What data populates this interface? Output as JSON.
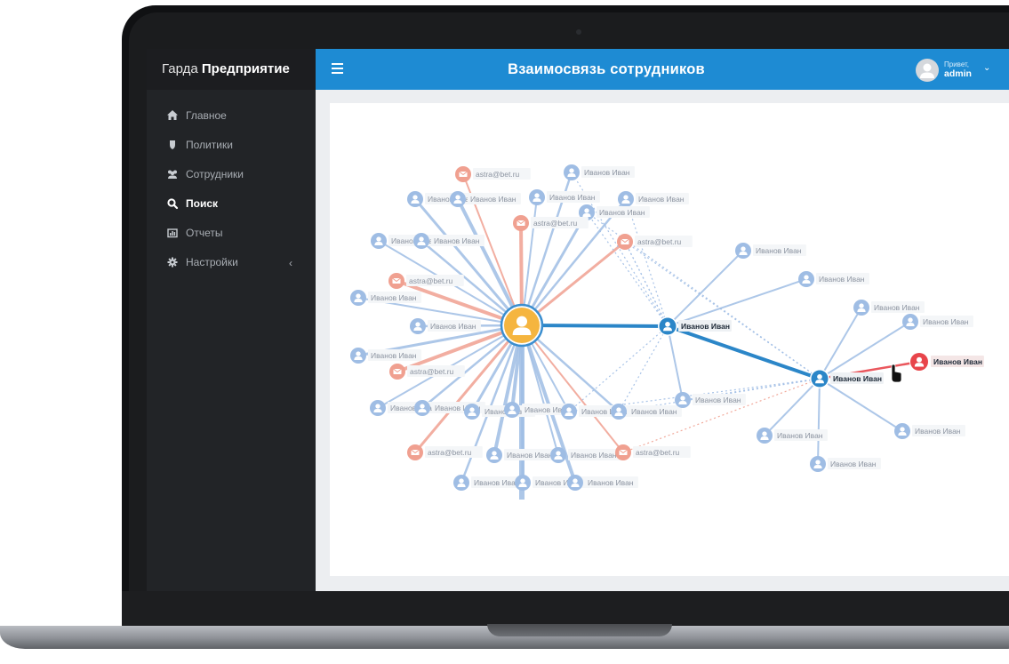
{
  "app": {
    "brand_prefix": "Гарда",
    "brand_name": "Предприятие"
  },
  "header": {
    "title": "Взаимосвязь сотрудников",
    "greeting": "Привет,",
    "username": "admin"
  },
  "sidebar": {
    "items": [
      {
        "label": "Главное",
        "icon": "home-icon",
        "active": false
      },
      {
        "label": "Политики",
        "icon": "shield-icon",
        "active": false
      },
      {
        "label": "Сотрудники",
        "icon": "users-icon",
        "active": false
      },
      {
        "label": "Поиск",
        "icon": "search-icon",
        "active": true
      },
      {
        "label": "Отчеты",
        "icon": "chart-icon",
        "active": false
      },
      {
        "label": "Настройки",
        "icon": "gear-icon",
        "active": false,
        "has_submenu": true
      }
    ]
  },
  "graph": {
    "colors": {
      "person": "#9fbde4",
      "email": "#f0a090",
      "center": "#f5b53f",
      "selected": "#2b86c8",
      "alert": "#e8454b"
    },
    "person_name": "Иванов Иван",
    "email_label": "astra@bet.ru"
  }
}
